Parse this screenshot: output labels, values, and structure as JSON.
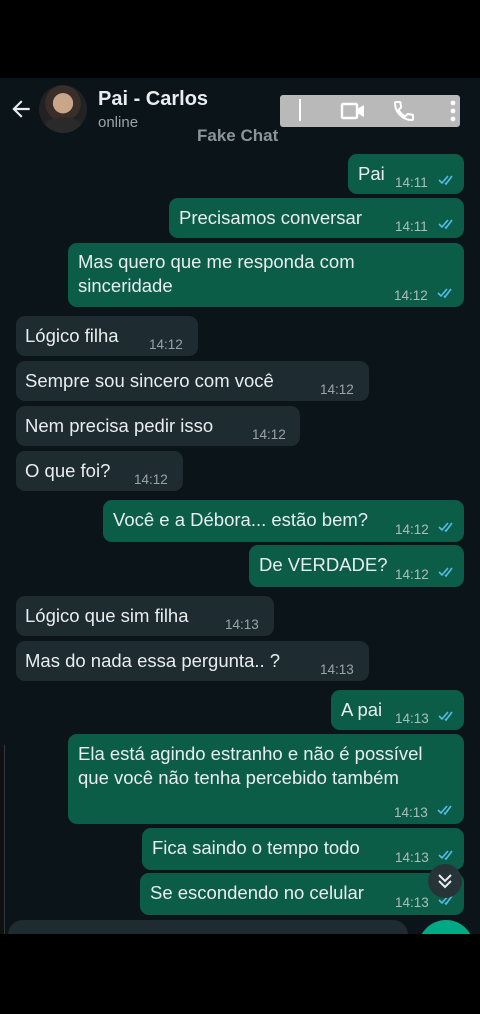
{
  "header": {
    "contact_name": "Pai - Carlos",
    "status": "online",
    "watermark": "Fake Chat",
    "icons": [
      "back-arrow-icon",
      "video-call-icon",
      "voice-call-icon",
      "more-options-icon"
    ]
  },
  "messages": [
    {
      "dir": "out",
      "text": "Pai",
      "time": "14:11"
    },
    {
      "dir": "out",
      "text": "Precisamos conversar",
      "time": "14:11"
    },
    {
      "dir": "out",
      "text": "Mas quero que me responda com sinceridade",
      "time": "14:12"
    },
    {
      "dir": "in",
      "text": "Lógico filha",
      "time": "14:12"
    },
    {
      "dir": "in",
      "text": "Sempre sou sincero com você",
      "time": "14:12"
    },
    {
      "dir": "in",
      "text": "Nem precisa pedir isso",
      "time": "14:12"
    },
    {
      "dir": "in",
      "text": "O que foi?",
      "time": "14:12"
    },
    {
      "dir": "out",
      "text": "Você e a Débora... estão bem?",
      "time": "14:12"
    },
    {
      "dir": "out",
      "text": "De VERDADE?",
      "time": "14:12"
    },
    {
      "dir": "in",
      "text": "Lógico que sim filha",
      "time": "14:13"
    },
    {
      "dir": "in",
      "text": "Mas do nada essa pergunta.. ?",
      "time": "14:13"
    },
    {
      "dir": "out",
      "text": "A pai",
      "time": "14:13"
    },
    {
      "dir": "out",
      "text": "Ela está agindo estranho e não é possível que você não tenha percebido também",
      "time": "14:13"
    },
    {
      "dir": "out",
      "text": "Fica saindo o tempo todo",
      "time": "14:13"
    },
    {
      "dir": "out",
      "text": "Se escondendo no celular",
      "time": "14:13"
    }
  ],
  "colors": {
    "outgoing": "#0c5d47",
    "incoming": "#1e2b31",
    "read_ticks": "#53bdeb",
    "background": "#0b1418"
  }
}
